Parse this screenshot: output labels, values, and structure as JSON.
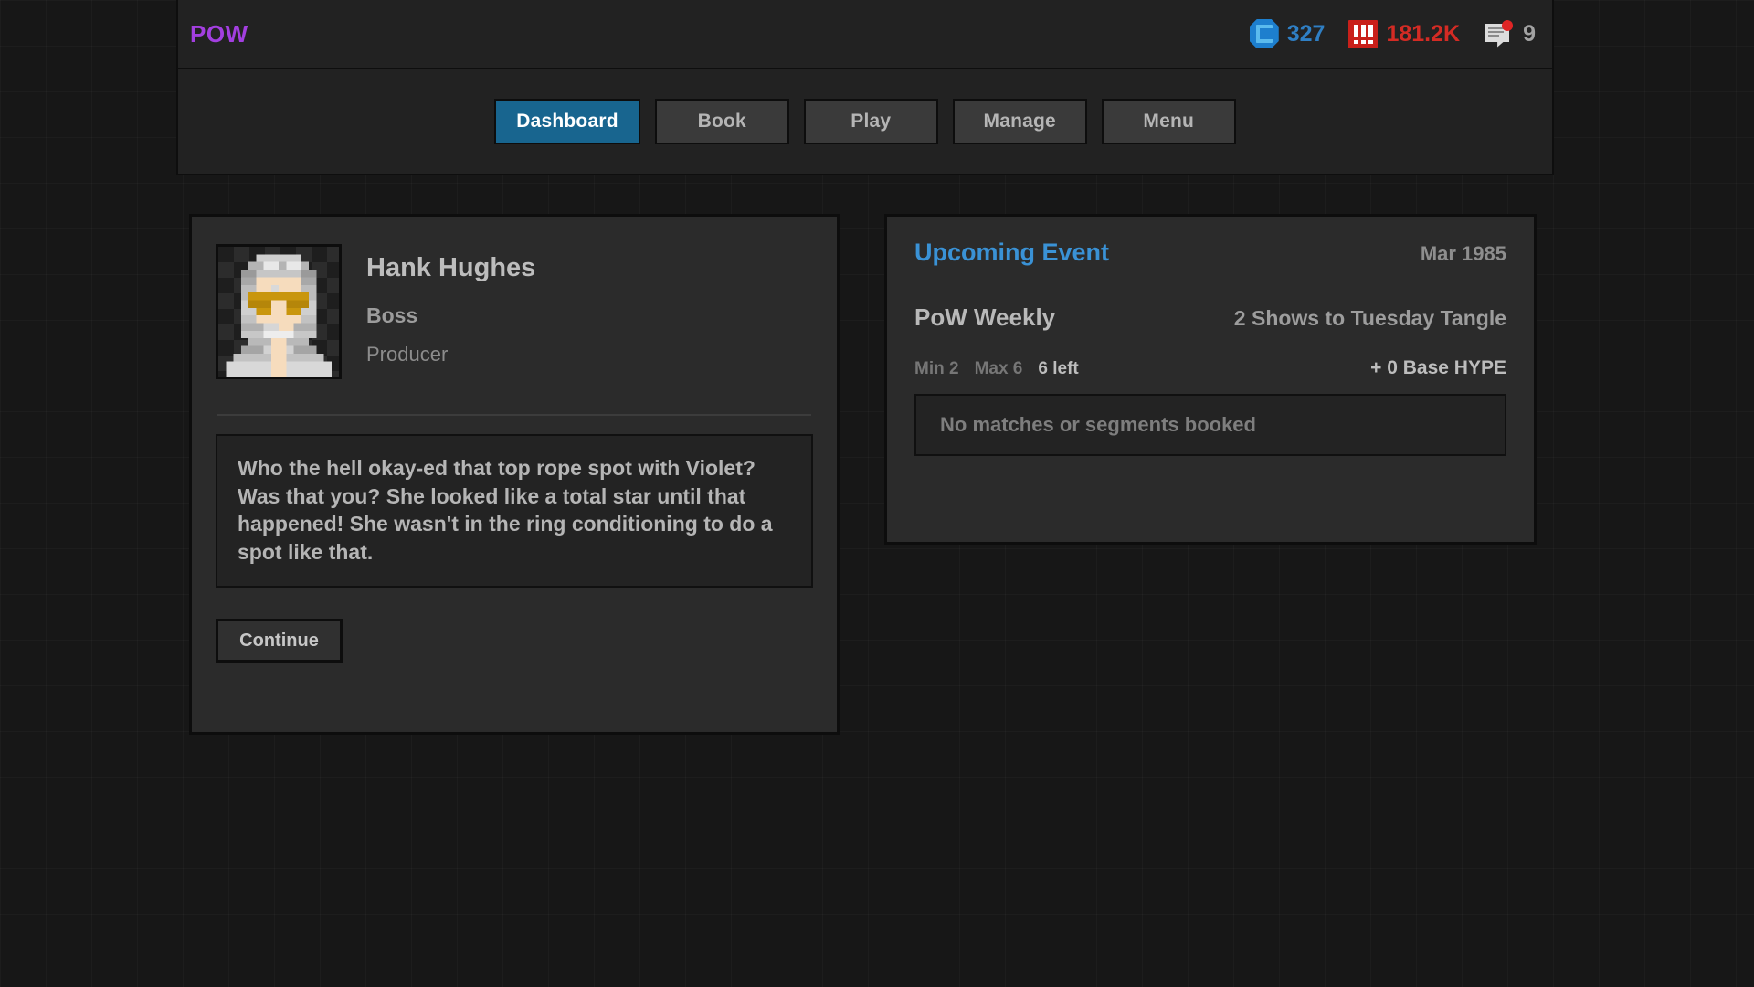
{
  "header": {
    "brand": "POW",
    "stats": [
      {
        "icon": "cash-coin-icon",
        "value": "327",
        "kind": "cash"
      },
      {
        "icon": "hype-icon",
        "value": "181.2K",
        "kind": "hype"
      },
      {
        "icon": "news-message-icon",
        "value": "9",
        "kind": "news"
      }
    ]
  },
  "nav": {
    "items": [
      {
        "label": "Dashboard",
        "active": true
      },
      {
        "label": "Book",
        "active": false
      },
      {
        "label": "Play",
        "active": false
      },
      {
        "label": "Manage",
        "active": false
      },
      {
        "label": "Menu",
        "active": false
      }
    ]
  },
  "character_card": {
    "avatar_icon": "pixel-portrait-avatar",
    "name": "Hank Hughes",
    "role": "Boss",
    "job": "Producer",
    "dialogue": "Who the hell okay-ed that top rope spot with Violet? Was that you? She looked like a total star until that happened! She wasn't in the ring conditioning to do a spot like that.",
    "continue_label": "Continue"
  },
  "upcoming_event": {
    "title": "Upcoming Event",
    "date": "Mar 1985",
    "event_name": "PoW Weekly",
    "shows_note": "2 Shows to Tuesday Tangle",
    "min_label": "Min 2",
    "max_label": "Max 6",
    "left_label": "6 left",
    "base_hype": "+ 0 Base HYPE",
    "empty_slot_text": "No matches or segments booked"
  },
  "colors": {
    "brand": "#a33fe0",
    "accent_blue": "#3a92d6",
    "active_tab": "#18658f",
    "cash": "#2f7fc4",
    "hype": "#d42b24",
    "page_bg": "#171717",
    "panel_bg": "#2b2b2b"
  }
}
